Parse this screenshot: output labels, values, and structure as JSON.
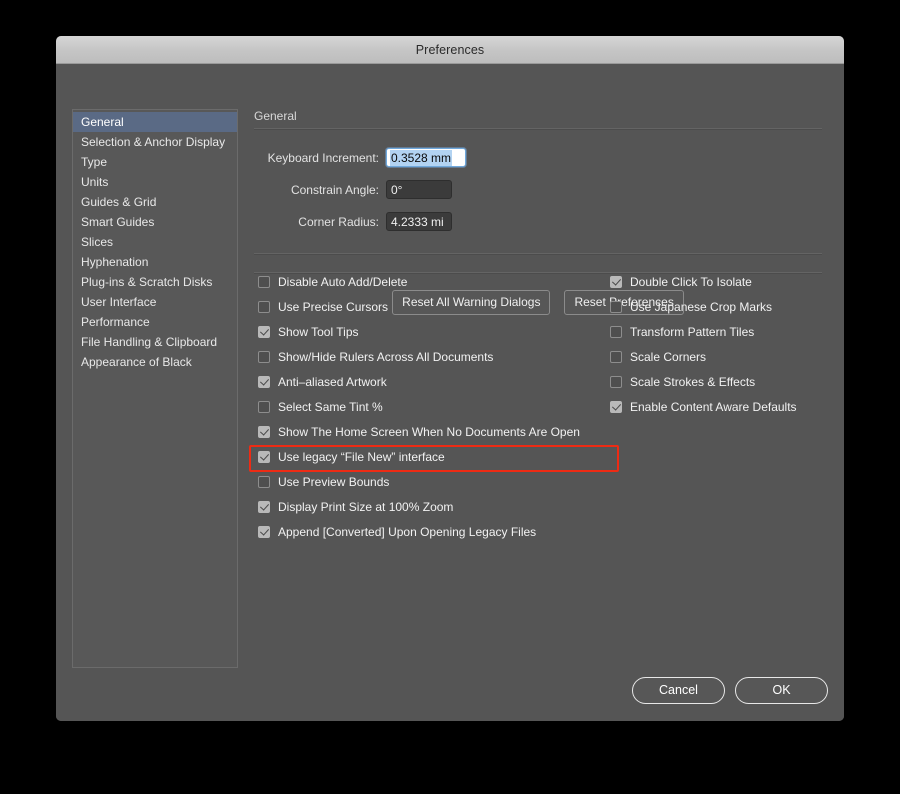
{
  "window": {
    "title": "Preferences"
  },
  "sidebar": {
    "items": [
      {
        "label": "General",
        "selected": true
      },
      {
        "label": "Selection & Anchor Display",
        "selected": false
      },
      {
        "label": "Type",
        "selected": false
      },
      {
        "label": "Units",
        "selected": false
      },
      {
        "label": "Guides & Grid",
        "selected": false
      },
      {
        "label": "Smart Guides",
        "selected": false
      },
      {
        "label": "Slices",
        "selected": false
      },
      {
        "label": "Hyphenation",
        "selected": false
      },
      {
        "label": "Plug-ins & Scratch Disks",
        "selected": false
      },
      {
        "label": "User Interface",
        "selected": false
      },
      {
        "label": "Performance",
        "selected": false
      },
      {
        "label": "File Handling & Clipboard",
        "selected": false
      },
      {
        "label": "Appearance of Black",
        "selected": false
      }
    ]
  },
  "main": {
    "section_title": "General",
    "fields": [
      {
        "label": "Keyboard Increment:",
        "value": "0.3528 mm",
        "state": "focused-selected"
      },
      {
        "label": "Constrain Angle:",
        "value": "0°",
        "state": "normal"
      },
      {
        "label": "Corner Radius:",
        "value": "4.2333 mi",
        "state": "normal"
      }
    ],
    "checkboxes_left": [
      {
        "label": "Disable Auto Add/Delete",
        "checked": false
      },
      {
        "label": "Use Precise Cursors",
        "checked": false
      },
      {
        "label": "Show Tool Tips",
        "checked": true
      },
      {
        "label": "Show/Hide Rulers Across All Documents",
        "checked": false
      },
      {
        "label": "Anti–aliased Artwork",
        "checked": true
      },
      {
        "label": "Select Same Tint %",
        "checked": false
      },
      {
        "label": "Show The Home Screen When No Documents Are Open",
        "checked": true
      },
      {
        "label": "Use legacy “File New” interface",
        "checked": true,
        "highlighted": true
      },
      {
        "label": "Use Preview Bounds",
        "checked": false
      },
      {
        "label": "Display Print Size at 100% Zoom",
        "checked": true
      },
      {
        "label": "Append [Converted] Upon Opening Legacy Files",
        "checked": true
      }
    ],
    "checkboxes_right": [
      {
        "label": "Double Click To Isolate",
        "checked": true
      },
      {
        "label": "Use Japanese Crop Marks",
        "checked": false
      },
      {
        "label": "Transform Pattern Tiles",
        "checked": false
      },
      {
        "label": "Scale Corners",
        "checked": false
      },
      {
        "label": "Scale Strokes & Effects",
        "checked": false
      },
      {
        "label": "Enable Content Aware Defaults",
        "checked": true
      }
    ],
    "reset_buttons": [
      {
        "label": "Reset All Warning Dialogs"
      },
      {
        "label": "Reset Preferences"
      }
    ]
  },
  "footer": {
    "cancel_label": "Cancel",
    "ok_label": "OK"
  },
  "colors": {
    "dialog_background": "#555555",
    "titlebar": "#c6c6c6",
    "sidebar_background": "#585858",
    "selection_blue": "#5a6a85",
    "highlight_red": "#ee2b14",
    "field_focus_selection": "#b2d3f2"
  }
}
